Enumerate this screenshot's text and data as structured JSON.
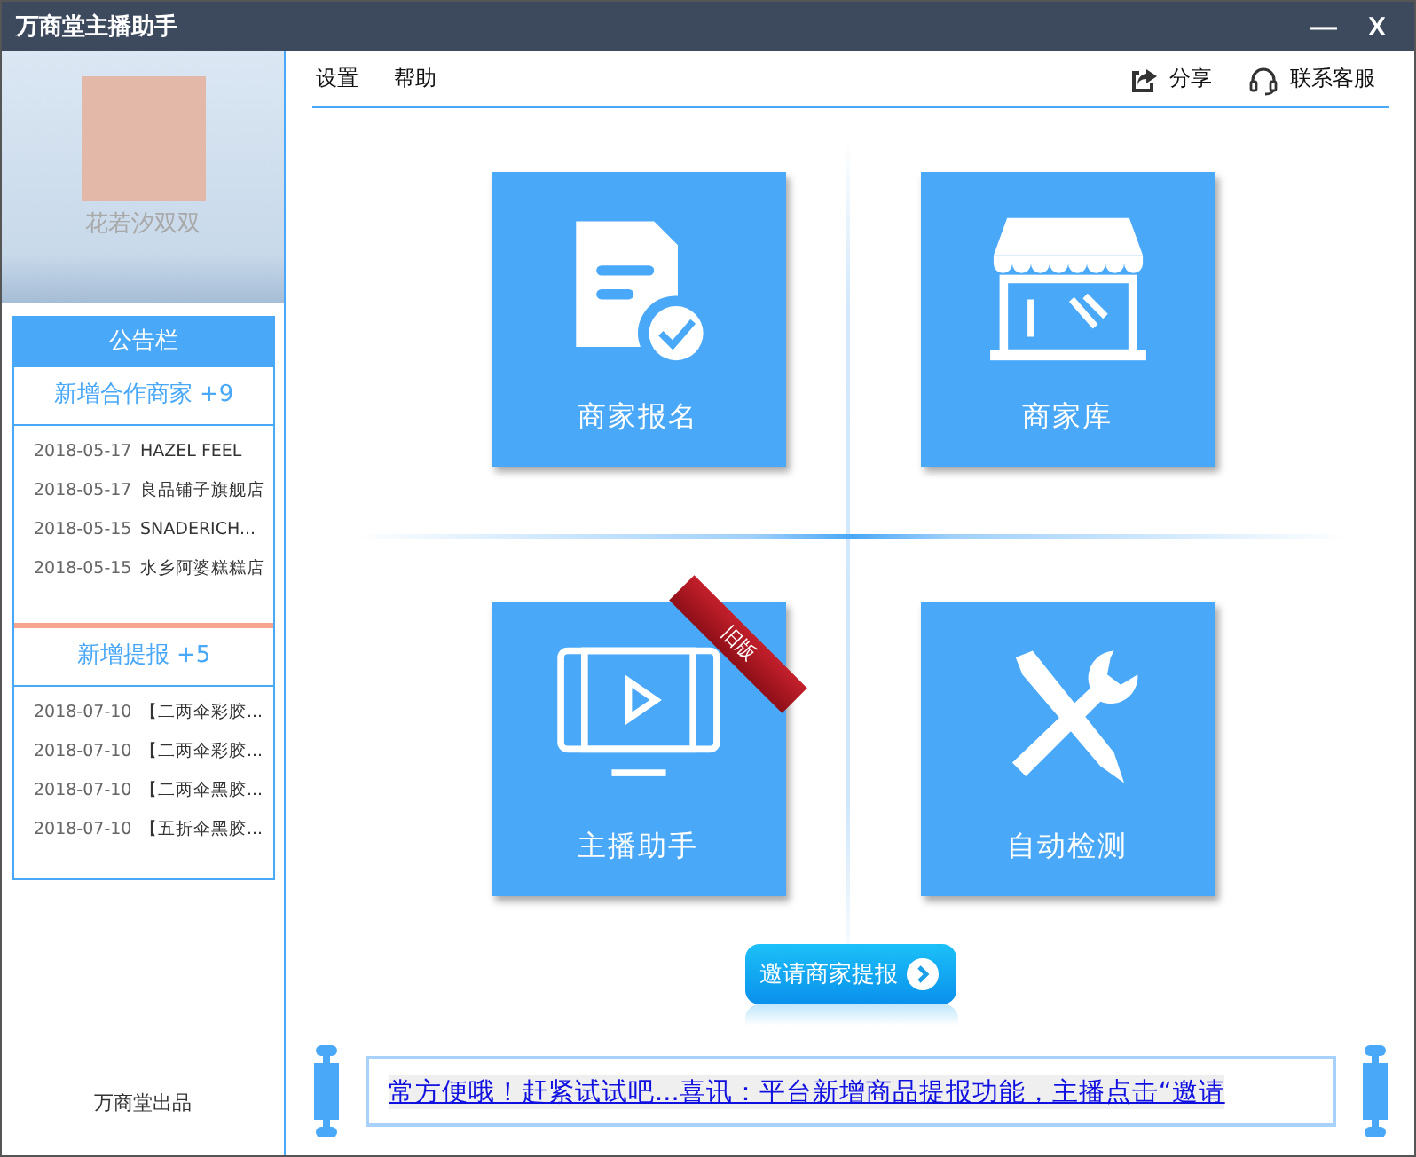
{
  "window": {
    "title": "万商堂主播助手",
    "minimize": "—",
    "close": "X"
  },
  "profile": {
    "name": "花若汐双双"
  },
  "menu": [
    {
      "label": "设置"
    },
    {
      "label": "帮助"
    }
  ],
  "actions": [
    {
      "kind": "share",
      "label": "分享"
    },
    {
      "kind": "support",
      "label": "联系客服"
    }
  ],
  "notice_board": {
    "title": "公告栏",
    "sections": [
      {
        "title": "新增合作商家 +9",
        "items": [
          {
            "date": "2018-05-17",
            "text": "HAZEL FEEL"
          },
          {
            "date": "2018-05-17",
            "text": "良品铺子旗舰店"
          },
          {
            "date": "2018-05-15",
            "text": "SNADERICH..."
          },
          {
            "date": "2018-05-15",
            "text": "水乡阿婆糕糕店"
          }
        ]
      },
      {
        "title": "新增提报 +5",
        "items": [
          {
            "date": "2018-07-10",
            "text": "【二两伞彩胶..."
          },
          {
            "date": "2018-07-10",
            "text": "【二两伞彩胶..."
          },
          {
            "date": "2018-07-10",
            "text": "【二两伞黑胶..."
          },
          {
            "date": "2018-07-10",
            "text": "【五折伞黑胶..."
          }
        ]
      }
    ]
  },
  "footer": "万商堂出品",
  "tiles": [
    {
      "kind": "signup",
      "label": "商家报名"
    },
    {
      "kind": "store",
      "label": "商家库"
    },
    {
      "kind": "streamer",
      "label": "主播助手",
      "ribbon": "旧版"
    },
    {
      "kind": "check",
      "label": "自动检测"
    }
  ],
  "invite_button": {
    "label": "邀请商家提报"
  },
  "marquee": {
    "text": "常方便哦！赶紧试试吧...喜讯：平台新增商品提报功能，主播点击“邀请"
  }
}
